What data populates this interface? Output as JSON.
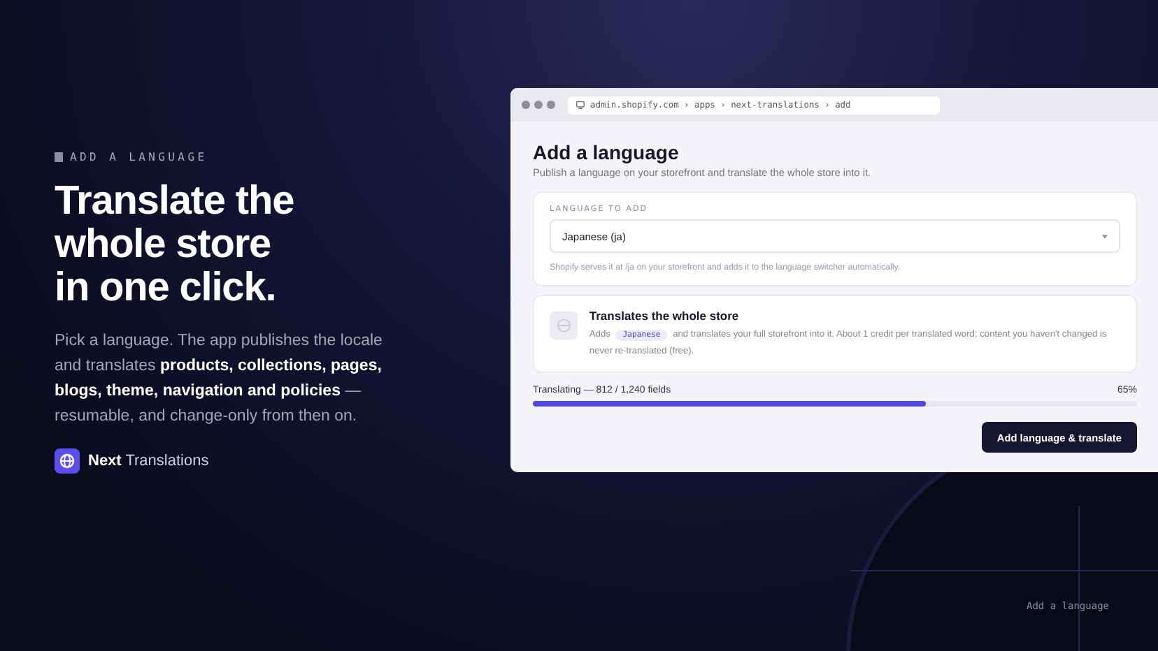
{
  "eyebrow": "ADD A LANGUAGE",
  "headline_lines": [
    "Translate the",
    "whole store",
    "in one click."
  ],
  "description": "Pick a language. The app publishes the locale and translates **products, collections, pages, blogs, theme, navigation and policies** — resumable, and change-only from then on.",
  "brand": "**Next** Translations",
  "browser": {
    "url": "admin.shopify.com › apps › next-translations › add"
  },
  "page": {
    "title": "Add a language",
    "subtitle": "Publish a language on your storefront and translate the whole store into it.",
    "field": {
      "label": "LANGUAGE TO ADD",
      "value": "Japanese (ja)",
      "hint": "Shopify serves it at /ja on your storefront and adds it to the language switcher automatically."
    },
    "info": {
      "title": "Translates the whole store",
      "text": "Adds *Japanese* and translates your full storefront into it. About 1 credit per translated word; content you haven't changed is never re-translated (free)."
    },
    "progress": {
      "label": "Translating — 812 / 1,240 fields",
      "reading": "65%",
      "level": 0.65
    },
    "button": "Add language & translate"
  },
  "caption": "Add a language"
}
